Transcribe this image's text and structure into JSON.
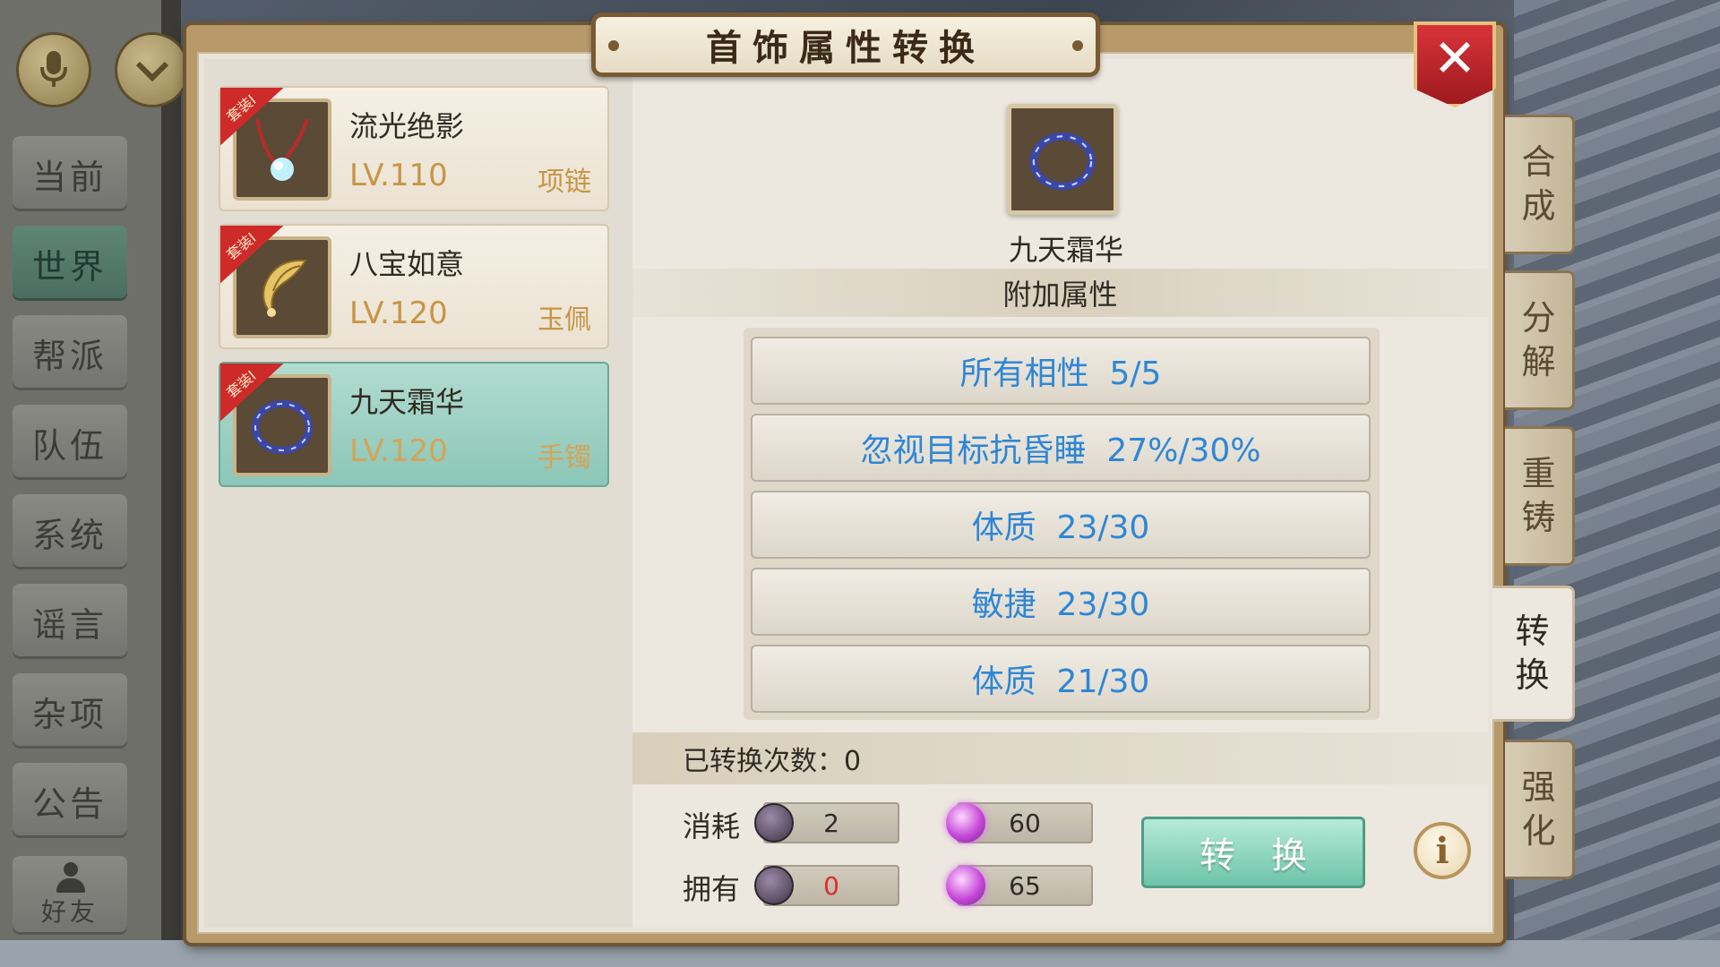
{
  "window": {
    "title": "首饰属性转换",
    "close_label": "✕"
  },
  "chat_sidebar": {
    "mic_icon": "mic-icon",
    "check_icon": "check-icon",
    "tabs": [
      {
        "label": "当前",
        "active": false
      },
      {
        "label": "世界",
        "active": true
      },
      {
        "label": "帮派",
        "active": false
      },
      {
        "label": "队伍",
        "active": false
      },
      {
        "label": "系统",
        "active": false
      },
      {
        "label": "谣言",
        "active": false
      },
      {
        "label": "杂项",
        "active": false
      },
      {
        "label": "公告",
        "active": false
      }
    ],
    "friend_label": "好友"
  },
  "items": [
    {
      "ribbon": "套装I",
      "name": "流光绝影",
      "level": "LV.110",
      "type": "项链",
      "icon": "necklace-icon",
      "selected": false
    },
    {
      "ribbon": "套装I",
      "name": "八宝如意",
      "level": "LV.120",
      "type": "玉佩",
      "icon": "jade-pendant-icon",
      "selected": false
    },
    {
      "ribbon": "套装I",
      "name": "九天霜华",
      "level": "LV.120",
      "type": "手镯",
      "icon": "bracelet-icon",
      "selected": true
    }
  ],
  "preview": {
    "name": "九天霜华",
    "icon": "bracelet-icon"
  },
  "attributes": {
    "header": "附加属性",
    "rows": [
      "所有相性  5/5",
      "忽视目标抗昏睡  27%/30%",
      "体质  23/30",
      "敏捷  23/30",
      "体质  21/30"
    ]
  },
  "convert_count": "已转换次数：0",
  "cost": {
    "consume_label": "消耗",
    "own_label": "拥有",
    "stone_consume": "2",
    "stone_own": "0",
    "orb_consume": "60",
    "orb_own": "65"
  },
  "convert_button": "转换",
  "info_button": "i",
  "side_tabs": [
    {
      "label": "合\n成",
      "active": false
    },
    {
      "label": "分\n解",
      "active": false
    },
    {
      "label": "重\n铸",
      "active": false
    },
    {
      "label": "转\n换",
      "active": true
    },
    {
      "label": "强\n化",
      "active": false
    }
  ],
  "colors": {
    "attr_text": "#2f86d6",
    "level_text": "#c79545",
    "selected_card": "#8cc6b7",
    "close_red": "#c22228",
    "count_red": "#e02a2a"
  }
}
